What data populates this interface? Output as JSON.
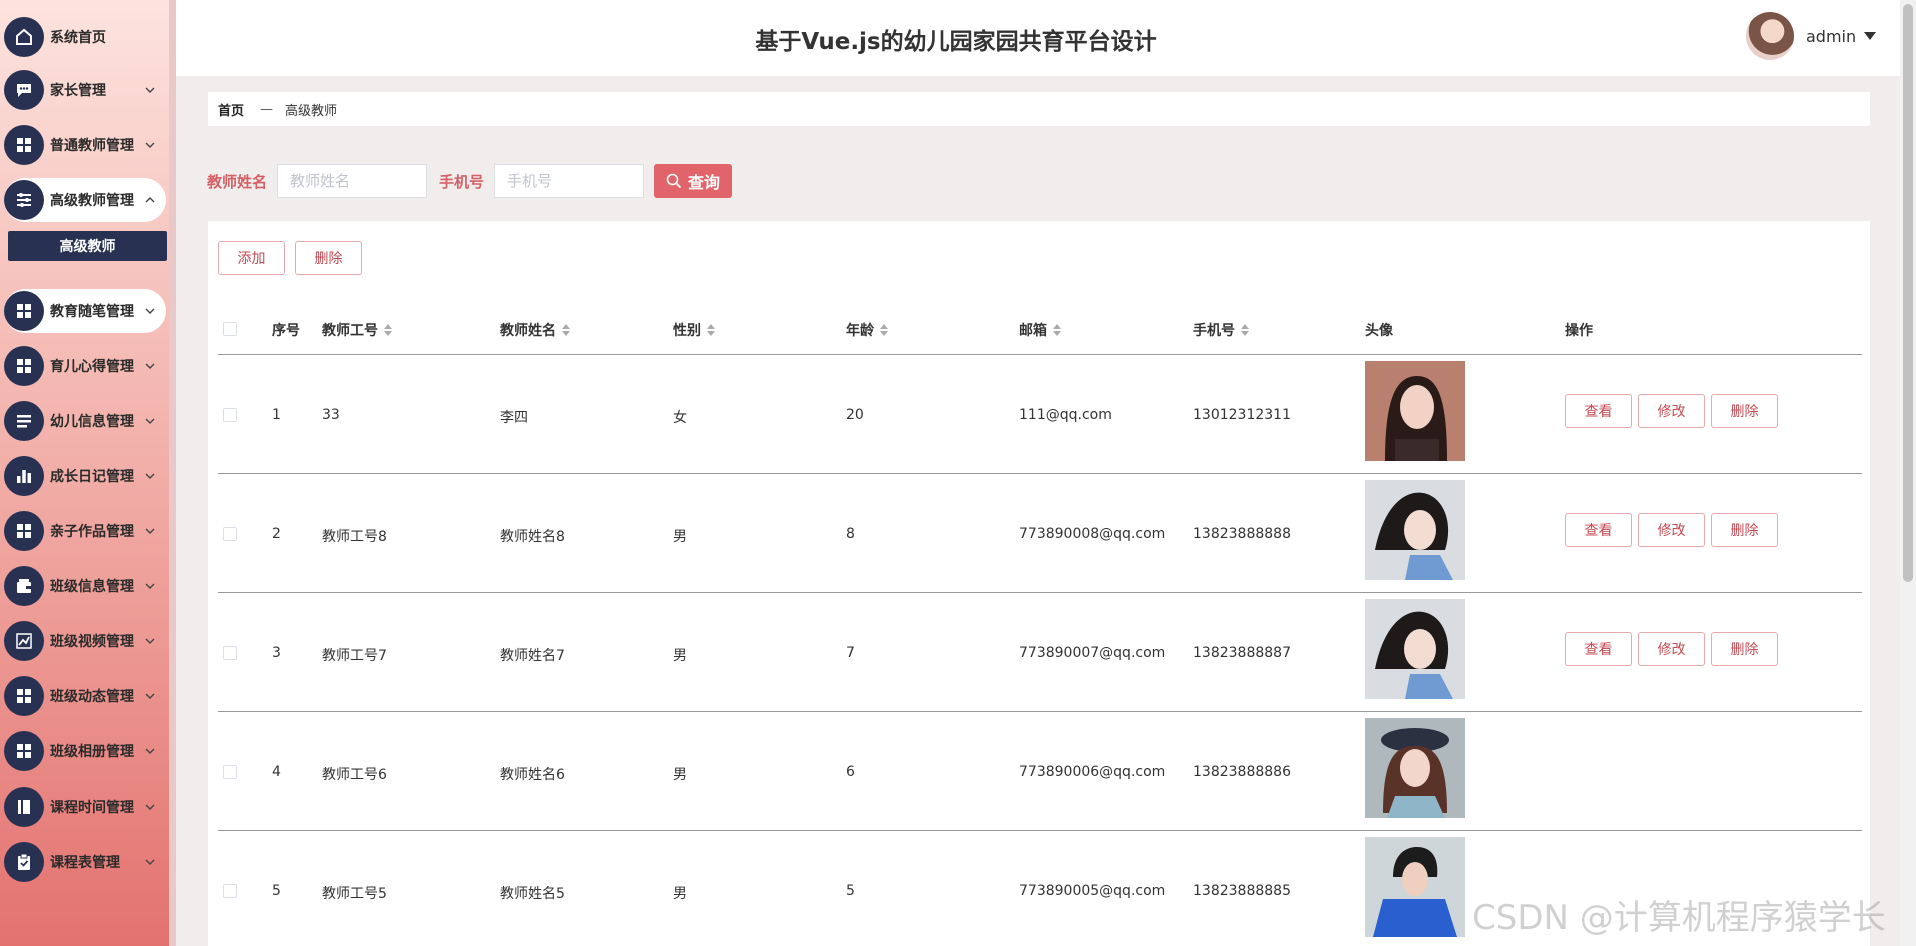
{
  "app": {
    "title": "基于Vue.js的幼儿园家园共育平台设计"
  },
  "user": {
    "name": "admin"
  },
  "sidebar": {
    "items": [
      {
        "label": "系统首页",
        "icon": "home-icon",
        "chevron": false
      },
      {
        "label": "家长管理",
        "icon": "chat-icon",
        "chevron": true
      },
      {
        "label": "普通教师管理",
        "icon": "grid-icon",
        "chevron": true
      },
      {
        "label": "高级教师管理",
        "icon": "sliders-icon",
        "chevron": true,
        "active": true,
        "expanded": true
      },
      {
        "label": "教育随笔管理",
        "icon": "grid-icon",
        "chevron": true,
        "active": true
      },
      {
        "label": "育儿心得管理",
        "icon": "grid-icon",
        "chevron": true
      },
      {
        "label": "幼儿信息管理",
        "icon": "list-icon",
        "chevron": true
      },
      {
        "label": "成长日记管理",
        "icon": "bar-chart-icon",
        "chevron": true
      },
      {
        "label": "亲子作品管理",
        "icon": "grid-icon",
        "chevron": true
      },
      {
        "label": "班级信息管理",
        "icon": "wallet-icon",
        "chevron": true
      },
      {
        "label": "班级视频管理",
        "icon": "trend-icon",
        "chevron": true
      },
      {
        "label": "班级动态管理",
        "icon": "grid-icon",
        "chevron": true
      },
      {
        "label": "班级相册管理",
        "icon": "grid-icon",
        "chevron": true
      },
      {
        "label": "课程时间管理",
        "icon": "book-icon",
        "chevron": true
      },
      {
        "label": "课程表管理",
        "icon": "clipboard-icon",
        "chevron": true
      }
    ],
    "submenu": {
      "label": "高级教师"
    }
  },
  "breadcrumb": {
    "home": "首页",
    "separator": "—",
    "current": "高级教师"
  },
  "search": {
    "name_label": "教师姓名",
    "name_placeholder": "教师姓名",
    "phone_label": "手机号",
    "phone_placeholder": "手机号",
    "button_label": "查询"
  },
  "toolbar": {
    "add_label": "添加",
    "delete_label": "删除"
  },
  "table": {
    "columns": {
      "index": "序号",
      "teacher_no": "教师工号",
      "teacher_name": "教师姓名",
      "gender": "性别",
      "age": "年龄",
      "email": "邮箱",
      "phone": "手机号",
      "avatar": "头像",
      "actions": "操作"
    },
    "rows": [
      {
        "index": "1",
        "teacher_no": "33",
        "teacher_name": "李四",
        "gender": "女",
        "age": "20",
        "email": "111@qq.com",
        "phone": "13012312311",
        "photo": "photo-a"
      },
      {
        "index": "2",
        "teacher_no": "教师工号8",
        "teacher_name": "教师姓名8",
        "gender": "男",
        "age": "8",
        "email": "773890008@qq.com",
        "phone": "13823888888",
        "photo": "photo-b"
      },
      {
        "index": "3",
        "teacher_no": "教师工号7",
        "teacher_name": "教师姓名7",
        "gender": "男",
        "age": "7",
        "email": "773890007@qq.com",
        "phone": "13823888887",
        "photo": "photo-b"
      },
      {
        "index": "4",
        "teacher_no": "教师工号6",
        "teacher_name": "教师姓名6",
        "gender": "男",
        "age": "6",
        "email": "773890006@qq.com",
        "phone": "13823888886",
        "photo": "photo-c"
      },
      {
        "index": "5",
        "teacher_no": "教师工号5",
        "teacher_name": "教师姓名5",
        "gender": "男",
        "age": "5",
        "email": "773890005@qq.com",
        "phone": "13823888885",
        "photo": "photo-d"
      }
    ],
    "row_actions": {
      "view": "查看",
      "edit": "修改",
      "delete": "删除"
    }
  },
  "watermark": "CSDN @计算机程序猿学长",
  "colors": {
    "accent": "#e0646a",
    "sidebar_icon_bg": "#283152",
    "outline": "#c44a52"
  }
}
